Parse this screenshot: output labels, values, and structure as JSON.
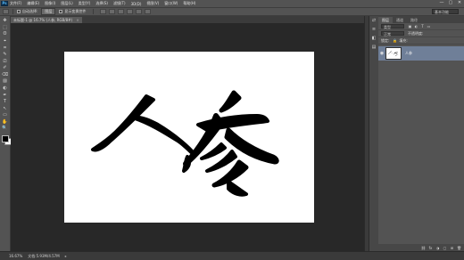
{
  "app": {
    "logo": "Ps"
  },
  "menu": [
    "文件(F)",
    "编辑(E)",
    "图像(I)",
    "图层(L)",
    "类型(Y)",
    "选择(S)",
    "滤镜(T)",
    "3D(D)",
    "视图(V)",
    "窗口(W)",
    "帮助(H)"
  ],
  "window_controls": [
    "—",
    "▢",
    "✕"
  ],
  "options": {
    "auto_select_label": "自动选择:",
    "auto_select_value": "图层",
    "transform_label": "显示变换控件",
    "workspace": "基本功能"
  },
  "doc_tab": {
    "title": "未标题-1 @ 16.7% (人参, RGB/8#)",
    "close": "×"
  },
  "tools": [
    "✥",
    "⬚",
    "ʘ",
    "⌖",
    "⌗",
    "✎",
    "⎚",
    "✐",
    "⌫",
    "▨",
    "◐",
    "✒",
    "T",
    "↖",
    "▭",
    "✋",
    "🔍"
  ],
  "status": {
    "zoom": "16.67%",
    "doc": "文档:5.93M/4.57M"
  },
  "panel_icons": [
    "⇄",
    "≡",
    "◧",
    "▤"
  ],
  "layers": {
    "tabs": [
      "图层",
      "通道",
      "路径"
    ],
    "filter_label": "类型",
    "blend_mode": "正常",
    "opacity_label": "不透明度:",
    "lock_label": "锁定:",
    "fill_label": "填充:",
    "items": [
      {
        "name": "人参",
        "visible_icon": "◉"
      }
    ],
    "footer_icons": [
      "⛓",
      "fx",
      "◑",
      "▢",
      "⊞",
      "🗑"
    ]
  },
  "colors": {
    "foreground": "#000000",
    "background": "#ffffff",
    "layer_selected": "#6f7f98"
  }
}
